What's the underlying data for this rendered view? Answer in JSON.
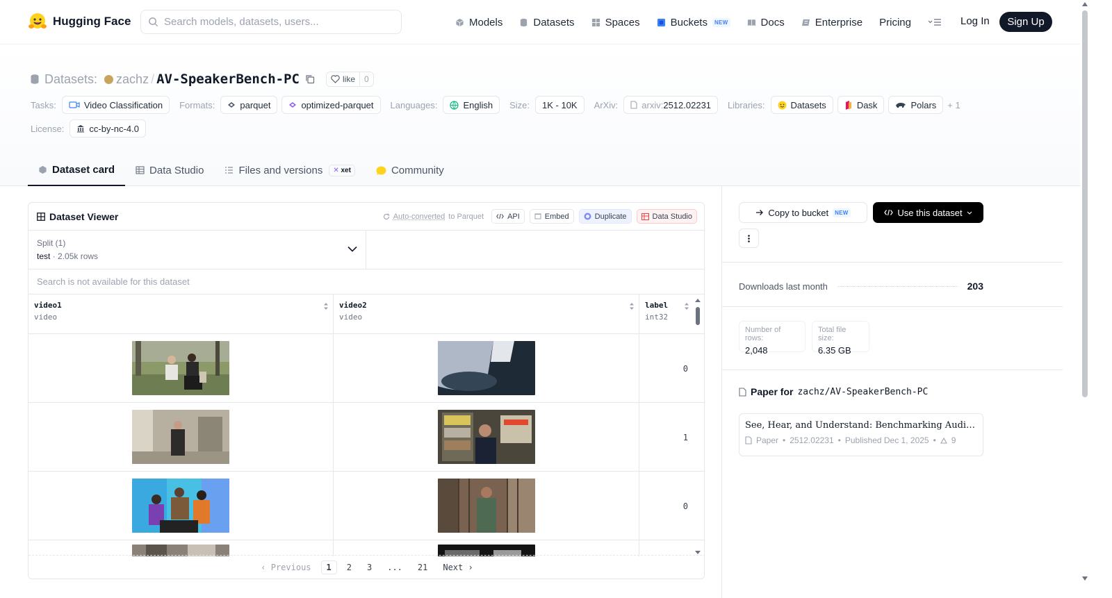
{
  "nav": {
    "brand": "Hugging Face",
    "search_placeholder": "Search models, datasets, users...",
    "links": [
      "Models",
      "Datasets",
      "Spaces",
      "Buckets",
      "Docs",
      "Enterprise",
      "Pricing"
    ],
    "buckets_badge": "NEW",
    "login": "Log In",
    "signup": "Sign Up"
  },
  "header": {
    "datasets_label": "Datasets:",
    "owner": "zachz",
    "separator": "/",
    "name": "AV-SpeakerBench-PC",
    "like_label": "like",
    "like_count": "0",
    "tasks_label": "Tasks:",
    "task": "Video Classification",
    "formats_label": "Formats:",
    "format1": "parquet",
    "format2": "optimized-parquet",
    "languages_label": "Languages:",
    "language": "English",
    "size_label": "Size:",
    "size": "1K - 10K",
    "arxiv_label": "ArXiv:",
    "arxiv_prefix": "arxiv:",
    "arxiv_id": "2512.02231",
    "libraries_label": "Libraries:",
    "lib1": "Datasets",
    "lib2": "Dask",
    "lib3": "Polars",
    "lib_more": "+ 1",
    "license_label": "License:",
    "license": "cc-by-nc-4.0"
  },
  "tabs": {
    "card": "Dataset card",
    "studio": "Data Studio",
    "files": "Files and versions",
    "xet": "xet",
    "community": "Community"
  },
  "viewer": {
    "title": "Dataset Viewer",
    "auto_link": "Auto-converted",
    "auto_rest": "to Parquet",
    "api": "API",
    "embed": "Embed",
    "duplicate": "Duplicate",
    "studio": "Data Studio",
    "split_label": "Split (1)",
    "split_name": "test",
    "split_rows": "2.05k rows",
    "split_sep": "·",
    "search_na": "Search is not available for this dataset",
    "columns": [
      {
        "name": "video1",
        "type": "video"
      },
      {
        "name": "video2",
        "type": "video"
      },
      {
        "name": "label",
        "type": "int32"
      }
    ],
    "rows": [
      {
        "label": "0"
      },
      {
        "label": "1"
      },
      {
        "label": "0"
      }
    ],
    "pager": {
      "prev": "Previous",
      "pages": [
        "1",
        "2",
        "3",
        "...",
        "21"
      ],
      "next": "Next"
    }
  },
  "sidebar": {
    "copy_bucket": "Copy to bucket",
    "copy_badge": "NEW",
    "use_dataset": "Use this dataset",
    "downloads_label": "Downloads last month",
    "downloads": "203",
    "rows_label": "Number of rows:",
    "rows_value": "2,048",
    "size_label": "Total file size:",
    "size_value": "6.35 GB",
    "paper_for": "Paper for",
    "paper_repo": "zachz/AV-SpeakerBench-PC",
    "paper_title": "See, Hear, and Understand: Benchmarking Audiovisual Human Speech Understanding",
    "paper_kind": "Paper",
    "paper_id": "2512.02231",
    "paper_date": "Published Dec 1, 2025",
    "paper_upvotes": "9"
  },
  "colors": {
    "accent": "#111827",
    "link_blue": "#3b82f6",
    "border": "#e5e7eb",
    "muted": "#9ca3af"
  }
}
